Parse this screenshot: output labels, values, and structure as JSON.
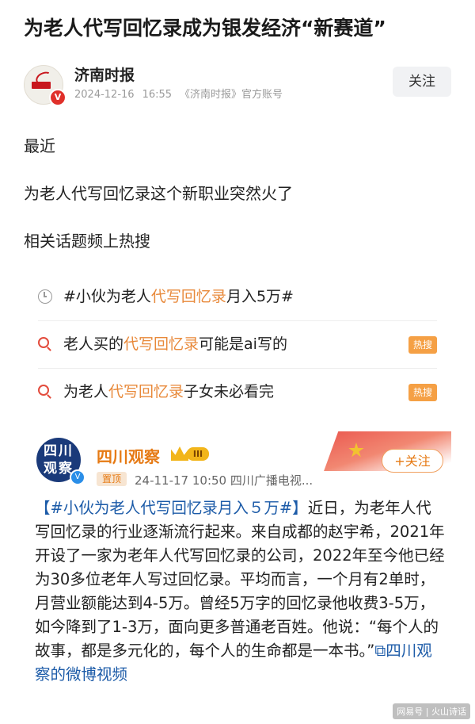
{
  "article": {
    "title": "为老人代写回忆录成为银发经济“新赛道”",
    "author": {
      "name": "济南时报",
      "date": "2024-12-16",
      "time": "16:55",
      "account": "《济南时报》官方账号",
      "follow_label": "关注"
    },
    "paragraphs": [
      "最近",
      "为老人代写回忆录这个新职业突然火了",
      "相关话题频上热搜"
    ]
  },
  "hot_searches": [
    {
      "prefix": "#小伙为老人",
      "highlight": "代写回忆录",
      "suffix": "月入5万#",
      "icon": "clock-icon",
      "tag": ""
    },
    {
      "prefix": "老人买的",
      "highlight": "代写回忆录",
      "suffix": "可能是ai写的",
      "icon": "search-icon",
      "tag": "热搜"
    },
    {
      "prefix": "为老人",
      "highlight": "代写回忆录",
      "suffix": "子女未必看完",
      "icon": "search-icon",
      "tag": "热搜"
    }
  ],
  "weibo": {
    "avatar_text": "四川观察",
    "name": "四川观察",
    "level": "III",
    "pinned": "置顶",
    "meta": "24-11-17 10:50  四川广播电视...",
    "follow_label": "+关注",
    "hashtag": "【#小伙为老人代写回忆录月入５万#】",
    "body": "近日，为老年人代写回忆录的行业逐渐流行起来。来自成都的赵宇希，2021年开设了一家为老年人代写回忆录的公司，2022年至今他已经为30多位老年人写过回忆录。平均而言，一个月有2单时，月营业额能达到4-5万。曾经5万字的回忆录他收费3-5万，如今降到了1-3万，面向更多普通老百姓。他说：“每个人的故事，都是多元化的，每个人的生命都是一本书。”",
    "video_link": "四川观察的微博视频"
  },
  "watermark": "网易号 | 火山诗话",
  "colors": {
    "highlight": "#e8893a",
    "link": "#1c5ba8",
    "hot_tag": "#f5a045",
    "weibo_name": "#e67a14"
  }
}
